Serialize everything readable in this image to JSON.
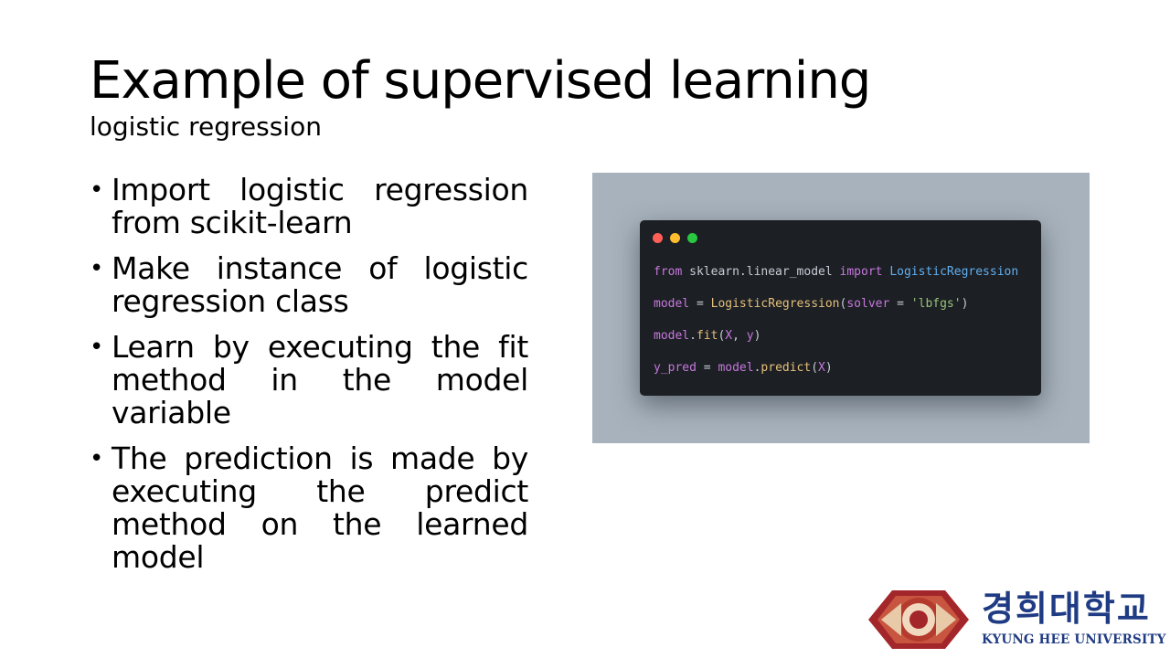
{
  "slide": {
    "title": "Example of supervised learning",
    "subtitle": "logistic regression",
    "bullets": [
      "Import logistic regression from scikit-learn",
      "Make instance of logistic regression class",
      "Learn by executing the fit method in the model variable",
      "The prediction is made by executing the predict method on the learned model"
    ],
    "bullet_symbol": "•"
  },
  "code_image": {
    "window_buttons": [
      "#ff5f57",
      "#febc2e",
      "#28c840"
    ],
    "lines": [
      [
        {
          "t": "from ",
          "c": "#c678dd"
        },
        {
          "t": "sklearn.linear_model ",
          "c": "#c8ccd4"
        },
        {
          "t": "import ",
          "c": "#c678dd"
        },
        {
          "t": "LogisticRegression",
          "c": "#61afef"
        }
      ],
      [
        {
          "t": "model ",
          "c": "#c678dd"
        },
        {
          "t": "= ",
          "c": "#c8ccd4"
        },
        {
          "t": "LogisticRegression",
          "c": "#e5c07b"
        },
        {
          "t": "(",
          "c": "#c8ccd4"
        },
        {
          "t": "solver ",
          "c": "#c678dd"
        },
        {
          "t": "= ",
          "c": "#c8ccd4"
        },
        {
          "t": "'lbfgs'",
          "c": "#98c379"
        },
        {
          "t": ")",
          "c": "#c8ccd4"
        }
      ],
      [
        {
          "t": "model",
          "c": "#c678dd"
        },
        {
          "t": ".",
          "c": "#c8ccd4"
        },
        {
          "t": "fit",
          "c": "#e5c07b"
        },
        {
          "t": "(",
          "c": "#c8ccd4"
        },
        {
          "t": "X",
          "c": "#c678dd"
        },
        {
          "t": ", ",
          "c": "#c8ccd4"
        },
        {
          "t": "y",
          "c": "#c678dd"
        },
        {
          "t": ")",
          "c": "#c8ccd4"
        }
      ],
      [
        {
          "t": "y_pred ",
          "c": "#c678dd"
        },
        {
          "t": "= ",
          "c": "#c8ccd4"
        },
        {
          "t": "model",
          "c": "#c678dd"
        },
        {
          "t": ".",
          "c": "#c8ccd4"
        },
        {
          "t": "predict",
          "c": "#e5c07b"
        },
        {
          "t": "(",
          "c": "#c8ccd4"
        },
        {
          "t": "X",
          "c": "#c678dd"
        },
        {
          "t": ")",
          "c": "#c8ccd4"
        }
      ]
    ]
  },
  "logo": {
    "korean_name": "경희대학교",
    "english_name": "KYUNG HEE UNIVERSITY",
    "brand_color": "#1f3b83",
    "emblem_color": "#a3262a"
  }
}
